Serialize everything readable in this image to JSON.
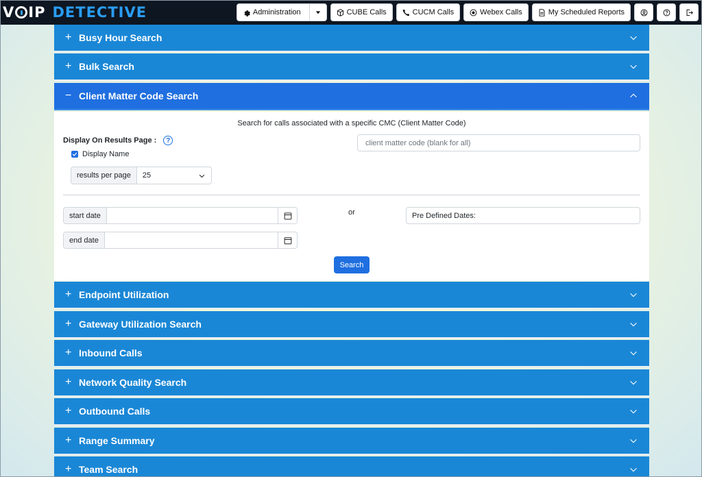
{
  "brand": {
    "part1": "V",
    "part2": "IP",
    "part3": "DETECTIVE"
  },
  "nav": {
    "administration": "Administration",
    "cube_calls": "CUBE Calls",
    "cucm_calls": "CUCM Calls",
    "webex_calls": "Webex Calls",
    "scheduled_reports": "My Scheduled Reports"
  },
  "sections_top": [
    {
      "label": "Busy Hour Search"
    },
    {
      "label": "Bulk Search"
    }
  ],
  "open_section": {
    "label": "Client Matter Code Search",
    "description": "Search for calls associated with a specific CMC (Client Matter Code)",
    "display_on_results_label": "Display On Results Page :",
    "display_name_label": "Display Name",
    "display_name_checked": true,
    "results_per_page_label": "results per page",
    "results_per_page_value": "25",
    "cmc_placeholder": "client matter code (blank for all)",
    "start_date_label": "start date",
    "end_date_label": "end date",
    "or_text": "or",
    "predefined_dates_label": "Pre Defined Dates:",
    "search_button": "Search"
  },
  "sections_bottom": [
    {
      "label": "Endpoint Utilization"
    },
    {
      "label": "Gateway Utilization Search"
    },
    {
      "label": "Inbound Calls"
    },
    {
      "label": "Network Quality Search"
    },
    {
      "label": "Outbound Calls"
    },
    {
      "label": "Range Summary"
    },
    {
      "label": "Team Search"
    }
  ],
  "colors": {
    "accordion_header": "#1a87d6",
    "accordion_open": "#1f6fe0",
    "topbar": "#0e1621",
    "brand_accent": "#2a9df4"
  }
}
